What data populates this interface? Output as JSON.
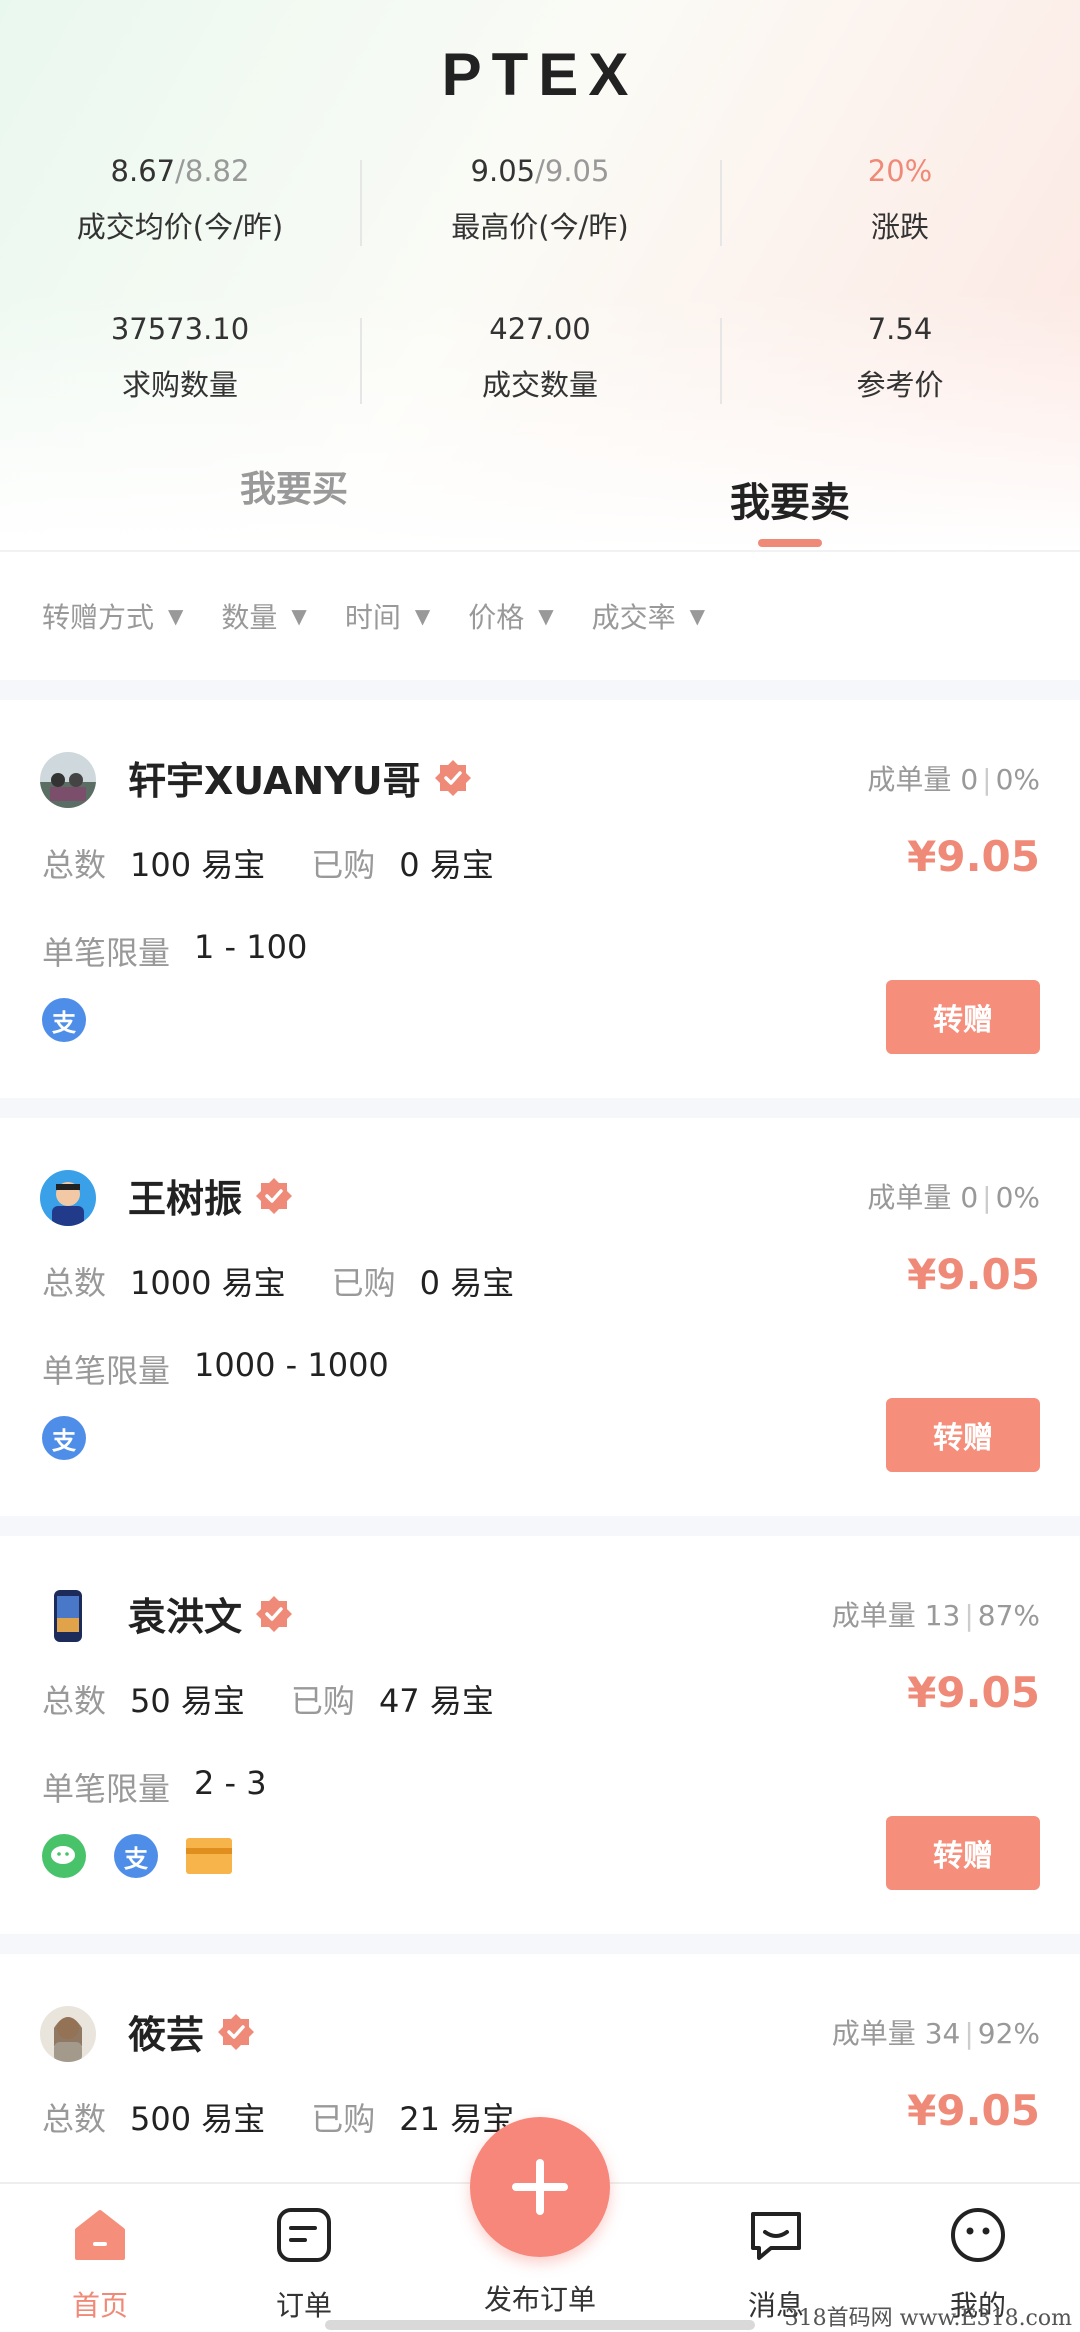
{
  "app": {
    "brand": "PTEX"
  },
  "stats": [
    {
      "value": "8.67",
      "prev": "/8.82",
      "label": "成交均价(今/昨)"
    },
    {
      "value": "9.05",
      "prev": "/9.05",
      "label": "最高价(今/昨)"
    },
    {
      "value": "20%",
      "prev": "",
      "label": "涨跌"
    },
    {
      "value": "37573.10",
      "prev": "",
      "label": "求购数量"
    },
    {
      "value": "427.00",
      "prev": "",
      "label": "成交数量"
    },
    {
      "value": "7.54",
      "prev": "",
      "label": "参考价"
    }
  ],
  "tabs": {
    "buy": "我要买",
    "sell": "我要卖",
    "active": "sell"
  },
  "filters": [
    "转赠方式",
    "数量",
    "时间",
    "价格",
    "成交率"
  ],
  "listings": [
    {
      "name": "轩宇XUANYU哥",
      "rate": "成单量 0",
      "rate_pct": "0%",
      "total_label": "总数",
      "total": "100 易宝",
      "bought_label": "已购",
      "bought": "0 易宝",
      "price": "¥9.05",
      "limit_label": "单笔限量",
      "limit": "1 - 100",
      "pay": [
        "alipay"
      ],
      "button": "转赠"
    },
    {
      "name": "王树振",
      "rate": "成单量 0",
      "rate_pct": "0%",
      "total_label": "总数",
      "total": "1000 易宝",
      "bought_label": "已购",
      "bought": "0 易宝",
      "price": "¥9.05",
      "limit_label": "单笔限量",
      "limit": "1000 - 1000",
      "pay": [
        "alipay"
      ],
      "button": "转赠"
    },
    {
      "name": "袁洪文",
      "rate": "成单量 13",
      "rate_pct": "87%",
      "total_label": "总数",
      "total": "50 易宝",
      "bought_label": "已购",
      "bought": "47 易宝",
      "price": "¥9.05",
      "limit_label": "单笔限量",
      "limit": "2 - 3",
      "pay": [
        "wechat",
        "alipay",
        "bank-card"
      ],
      "button": "转赠"
    },
    {
      "name": "筱芸",
      "rate": "成单量 34",
      "rate_pct": "92%",
      "total_label": "总数",
      "total": "500 易宝",
      "bought_label": "已购",
      "bought": "21 易宝",
      "price": "¥9.05"
    }
  ],
  "nav": {
    "home": "首页",
    "orders": "订单",
    "publish": "发布订单",
    "messages": "消息",
    "me": "我的"
  },
  "watermark": "318首码网 www.E318.com",
  "colors": {
    "accent": "#f08a78",
    "alipay": "#4f8ee8",
    "wechat": "#49c36a",
    "card": "#f6b44a"
  }
}
